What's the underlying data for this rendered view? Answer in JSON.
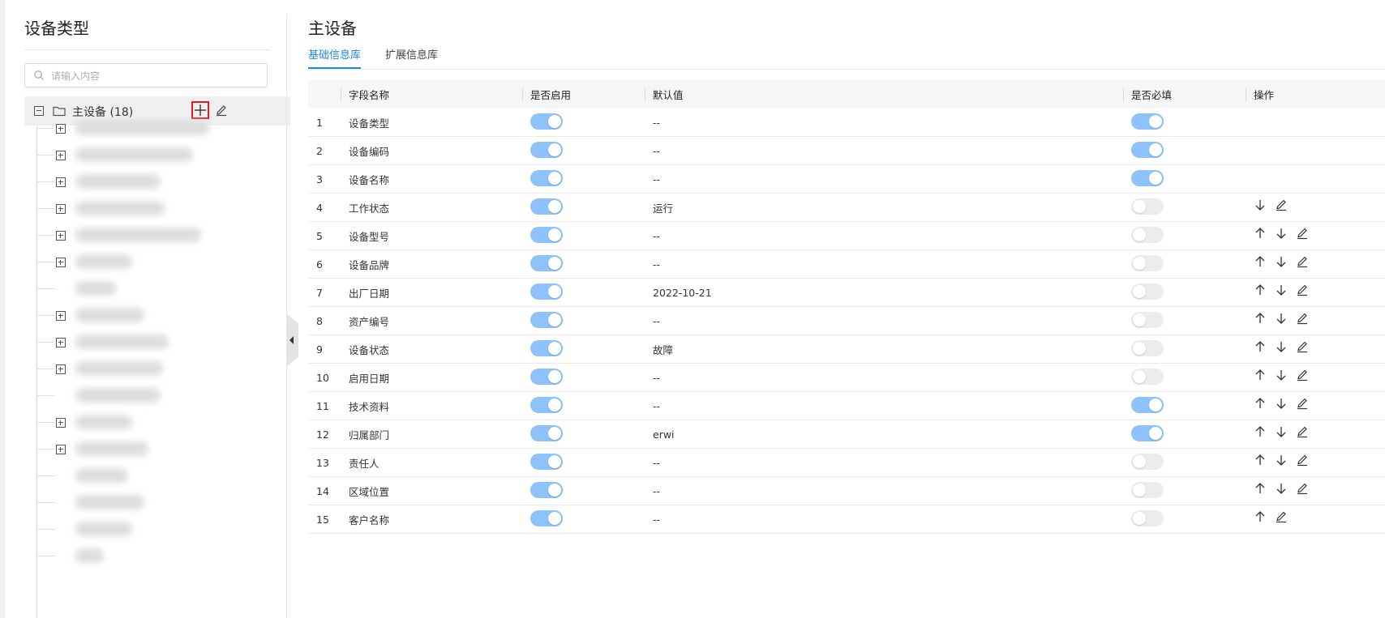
{
  "left_panel": {
    "title": "设备类型",
    "search_placeholder": "请输入内容",
    "root": {
      "label": "主设备 (18)"
    },
    "children": [
      {
        "expandable": true,
        "blur_width": 165
      },
      {
        "expandable": true,
        "blur_width": 145
      },
      {
        "expandable": true,
        "blur_width": 105
      },
      {
        "expandable": true,
        "blur_width": 110
      },
      {
        "expandable": true,
        "blur_width": 155
      },
      {
        "expandable": true,
        "blur_width": 70
      },
      {
        "expandable": false,
        "blur_width": 50
      },
      {
        "expandable": true,
        "blur_width": 85
      },
      {
        "expandable": true,
        "blur_width": 115
      },
      {
        "expandable": true,
        "blur_width": 108
      },
      {
        "expandable": false,
        "blur_width": 105
      },
      {
        "expandable": true,
        "blur_width": 70
      },
      {
        "expandable": true,
        "blur_width": 90
      },
      {
        "expandable": false,
        "blur_width": 65
      },
      {
        "expandable": false,
        "blur_width": 85
      },
      {
        "expandable": false,
        "blur_width": 70
      },
      {
        "expandable": false,
        "blur_width": 35
      }
    ]
  },
  "main": {
    "title": "主设备",
    "tabs": [
      {
        "label": "基础信息库",
        "active": true
      },
      {
        "label": "扩展信息库",
        "active": false
      }
    ],
    "table": {
      "headers": [
        "",
        "字段名称",
        "是否启用",
        "默认值",
        "是否必填",
        "操作"
      ],
      "rows": [
        {
          "idx": "1",
          "name": "设备类型",
          "enabled": true,
          "default": "--",
          "required": true,
          "ops": []
        },
        {
          "idx": "2",
          "name": "设备编码",
          "enabled": true,
          "default": "--",
          "required": true,
          "ops": []
        },
        {
          "idx": "3",
          "name": "设备名称",
          "enabled": true,
          "default": "--",
          "required": true,
          "ops": []
        },
        {
          "idx": "4",
          "name": "工作状态",
          "enabled": true,
          "default": "运行",
          "required": false,
          "ops": [
            "down",
            "edit"
          ]
        },
        {
          "idx": "5",
          "name": "设备型号",
          "enabled": true,
          "default": "--",
          "required": false,
          "ops": [
            "up",
            "down",
            "edit"
          ]
        },
        {
          "idx": "6",
          "name": "设备品牌",
          "enabled": true,
          "default": "--",
          "required": false,
          "ops": [
            "up",
            "down",
            "edit"
          ]
        },
        {
          "idx": "7",
          "name": "出厂日期",
          "enabled": true,
          "default": "2022-10-21",
          "required": false,
          "ops": [
            "up",
            "down",
            "edit"
          ]
        },
        {
          "idx": "8",
          "name": "资产编号",
          "enabled": true,
          "default": "--",
          "required": false,
          "ops": [
            "up",
            "down",
            "edit"
          ]
        },
        {
          "idx": "9",
          "name": "设备状态",
          "enabled": true,
          "default": "故障",
          "required": false,
          "ops": [
            "up",
            "down",
            "edit"
          ]
        },
        {
          "idx": "10",
          "name": "启用日期",
          "enabled": true,
          "default": "--",
          "required": false,
          "ops": [
            "up",
            "down",
            "edit"
          ]
        },
        {
          "idx": "11",
          "name": "技术资料",
          "enabled": true,
          "default": "--",
          "required": true,
          "ops": [
            "up",
            "down",
            "edit"
          ]
        },
        {
          "idx": "12",
          "name": "归属部门",
          "enabled": true,
          "default": "erwi",
          "required": true,
          "ops": [
            "up",
            "down",
            "edit"
          ]
        },
        {
          "idx": "13",
          "name": "责任人",
          "enabled": true,
          "default": "--",
          "required": false,
          "ops": [
            "up",
            "down",
            "edit"
          ]
        },
        {
          "idx": "14",
          "name": "区域位置",
          "enabled": true,
          "default": "--",
          "required": false,
          "ops": [
            "up",
            "down",
            "edit"
          ]
        },
        {
          "idx": "15",
          "name": "客户名称",
          "enabled": true,
          "default": "--",
          "required": false,
          "ops": [
            "up",
            "edit"
          ]
        }
      ]
    }
  },
  "colors": {
    "accent": "#1e88e5",
    "switch_on": "#8ec2fa",
    "switch_off": "#ececec",
    "highlight_border": "#e02020"
  }
}
